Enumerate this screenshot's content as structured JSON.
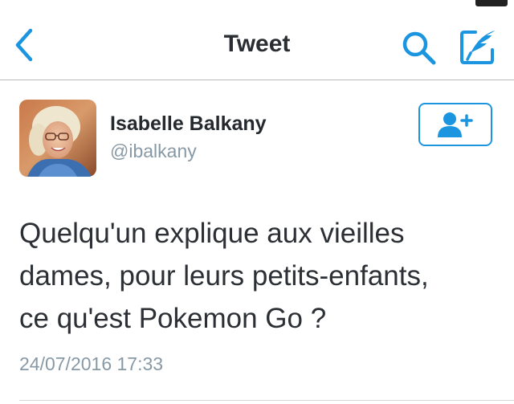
{
  "nav": {
    "title": "Tweet",
    "back_icon": "chevron-left-icon",
    "search_icon": "search-icon",
    "compose_icon": "compose-feather-icon",
    "accent_color": "#1b95e0"
  },
  "tweet": {
    "author": {
      "name": "Isabelle Balkany",
      "handle": "@ibalkany",
      "avatar_icon": "avatar-photo"
    },
    "follow_button_icon": "add-user-icon",
    "text": "Quelqu'un explique aux vieilles\ndames, pour leurs petits-enfants,\nce qu'est Pokemon Go ?",
    "timestamp": "24/07/2016 17:33"
  },
  "colors": {
    "accent": "#1b95e0",
    "secondary_text": "#8899a6",
    "primary_text": "#24292e",
    "divider": "#bcbcbc"
  }
}
